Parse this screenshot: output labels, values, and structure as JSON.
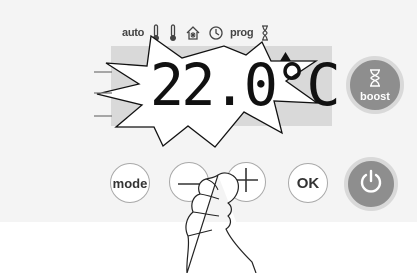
{
  "top_icons": {
    "auto_label": "auto",
    "prog_label": "prog",
    "icons": [
      "thermometer-icon",
      "thermometer-icon",
      "frost-protection-icon",
      "clock-icon",
      "hourglass-icon"
    ]
  },
  "display": {
    "temperature": "22.0°C"
  },
  "buttons": {
    "mode_label": "mode",
    "ok_label": "OK",
    "boost_label": "boost"
  },
  "colors": {
    "panel": "#f4f4f4",
    "lcd": "#d9d9d9",
    "button_dark": "#8e8e8e",
    "button_border": "#a8a8a8"
  }
}
